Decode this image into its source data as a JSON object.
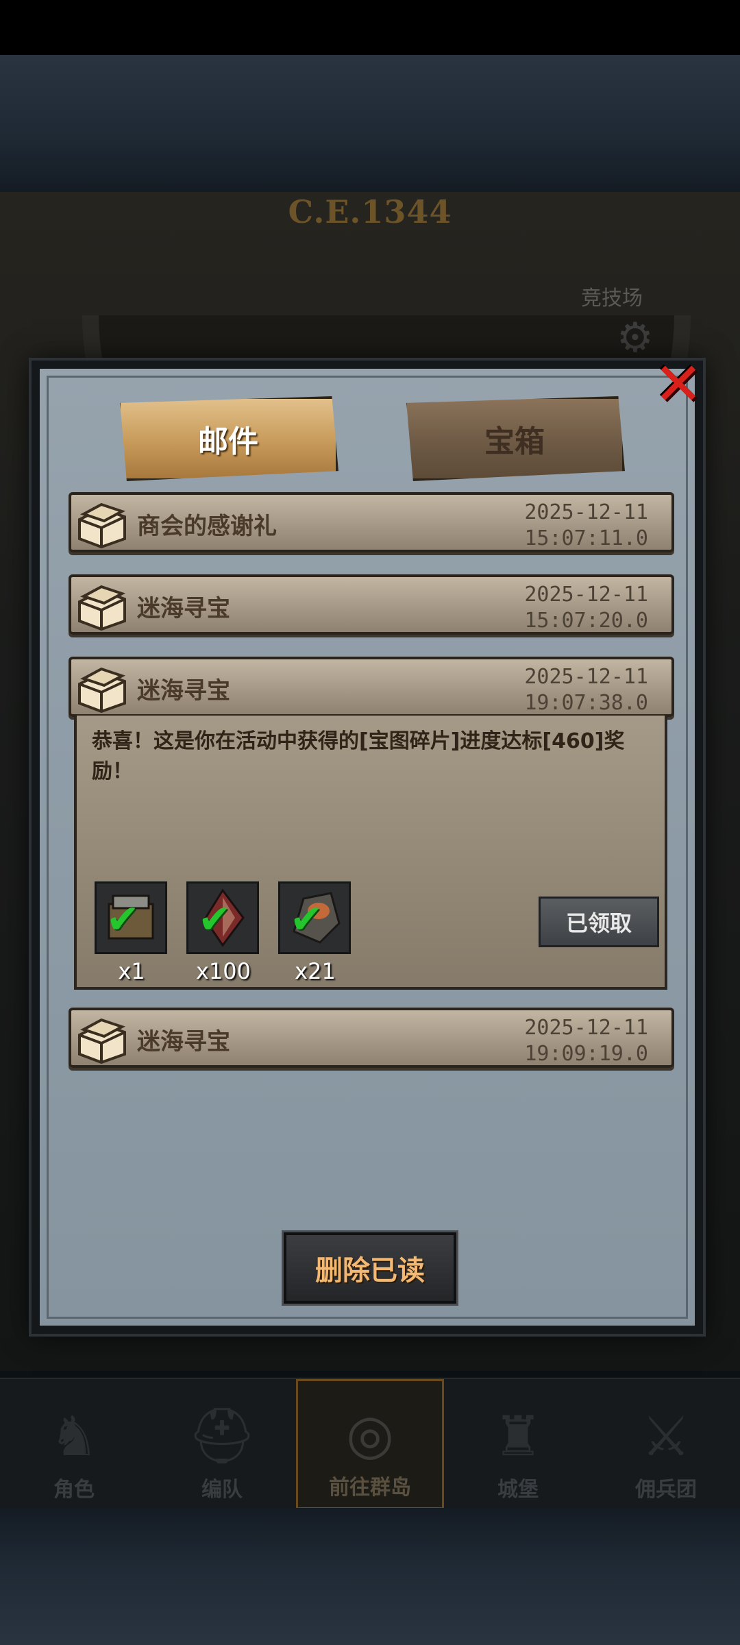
{
  "background": {
    "year_label": "C.E.1344",
    "arena_label": "竞技场"
  },
  "tabs": [
    {
      "label": "邮件",
      "active": true
    },
    {
      "label": "宝箱",
      "active": false
    }
  ],
  "mails": [
    {
      "title": "商会的感谢礼",
      "date": "2025-12-11",
      "time": "15:07:11.0"
    },
    {
      "title": "迷海寻宝",
      "date": "2025-12-11",
      "time": "15:07:20.0"
    },
    {
      "title": "迷海寻宝",
      "date": "2025-12-11",
      "time": "19:07:38.0",
      "expanded": true
    },
    {
      "title": "迷海寻宝",
      "date": "2025-12-11",
      "time": "19:09:19.0"
    }
  ],
  "expanded_mail": {
    "message": "恭喜！这是你在活动中获得的[宝图碎片]进度达标[460]奖励！",
    "rewards": [
      {
        "icon": "armor-chest-icon",
        "count": "x1",
        "claimed": true
      },
      {
        "icon": "map-fragment-icon",
        "count": "x100",
        "claimed": true
      },
      {
        "icon": "ore-stone-icon",
        "count": "x21",
        "claimed": true
      }
    ],
    "claim_status_label": "已领取"
  },
  "actions": {
    "delete_read_label": "删除已读"
  },
  "nav": [
    {
      "label": "角色",
      "icon": "knight-icon"
    },
    {
      "label": "编队",
      "icon": "helmet-icon"
    },
    {
      "label": "前往群岛",
      "icon": "globe-icon",
      "active": true
    },
    {
      "label": "城堡",
      "icon": "castle-icon"
    },
    {
      "label": "佣兵团",
      "icon": "mercenary-icon"
    }
  ],
  "colors": {
    "accent_gold": "#c79a5a",
    "close_red": "#d8211b",
    "check_green": "#24c52d",
    "delete_text": "#f3b872"
  }
}
